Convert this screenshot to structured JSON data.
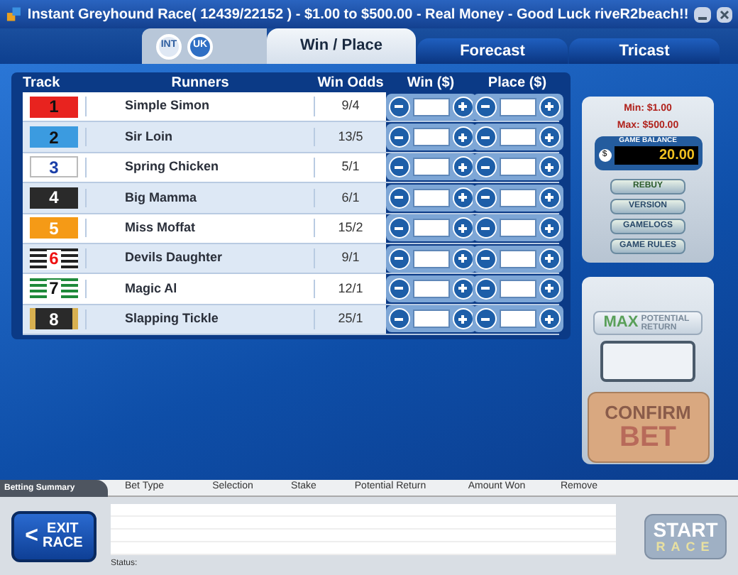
{
  "window": {
    "title": "Instant Greyhound Race( 12439/22152 ) - $1.00 to $500.00 - Real Money - Good Luck riveR2beach!!"
  },
  "region_toggles": [
    {
      "label": "INT",
      "selected": false
    },
    {
      "label": "UK",
      "selected": true
    }
  ],
  "tabs": [
    {
      "label": "Win / Place",
      "selected": true
    },
    {
      "label": "Forecast",
      "selected": false
    },
    {
      "label": "Tricast",
      "selected": false
    }
  ],
  "table": {
    "columns": [
      "Track",
      "Runners",
      "Win Odds",
      "Win ($)",
      "Place ($)"
    ],
    "rows": [
      {
        "track": "1",
        "kind": "red",
        "runner": "Simple Simon",
        "odds": "9/4"
      },
      {
        "track": "2",
        "kind": "blue",
        "runner": "Sir Loin",
        "odds": "13/5"
      },
      {
        "track": "3",
        "kind": "white",
        "runner": "Spring Chicken",
        "odds": "5/1"
      },
      {
        "track": "4",
        "kind": "black",
        "runner": "Big Mamma",
        "odds": "6/1"
      },
      {
        "track": "5",
        "kind": "orange",
        "runner": "Miss Moffat",
        "odds": "15/2"
      },
      {
        "track": "6",
        "kind": "striped-black",
        "runner": "Devils Daughter",
        "odds": "9/1"
      },
      {
        "track": "7",
        "kind": "striped-green",
        "runner": "Magic Al",
        "odds": "12/1"
      },
      {
        "track": "8",
        "kind": "black-gold",
        "runner": "Slapping Tickle",
        "odds": "25/1"
      }
    ]
  },
  "limits": {
    "min": "Min: $1.00",
    "max": "Max: $500.00"
  },
  "balance": {
    "label": "GAME BALANCE",
    "currency": "$",
    "value": "20.00"
  },
  "side_buttons": [
    "REBUY",
    "VERSION",
    "GAMELOGS",
    "GAME RULES"
  ],
  "max_return": {
    "label_big": "MAX",
    "label_small": "POTENTIAL RETURN"
  },
  "confirm": {
    "line1": "CONFIRM",
    "line2": "BET"
  },
  "summary": {
    "title": "Betting Summary",
    "columns": [
      "Bet Type",
      "Selection",
      "Stake",
      "Potential Return",
      "Amount Won",
      "Remove"
    ],
    "status_label": "Status:"
  },
  "exit_button": {
    "arrow": "<",
    "line1": "EXIT",
    "line2": "RACE"
  },
  "start_button": {
    "line1": "START",
    "line2": "RACE",
    "disabled": true
  }
}
